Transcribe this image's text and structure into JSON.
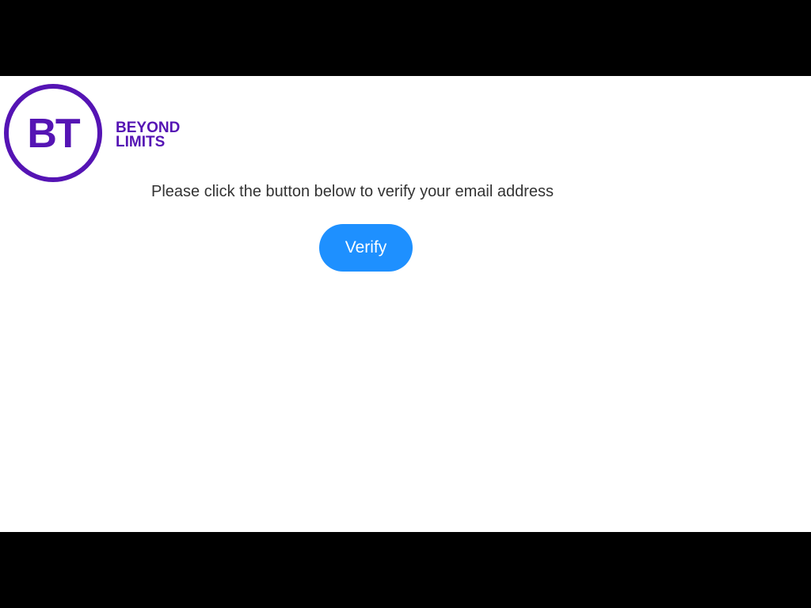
{
  "logo": {
    "initials": "BT",
    "tagline_line1": "BEYOND",
    "tagline_line2": "LIMITS"
  },
  "message": "Please click the button below to verify your email address",
  "verify_button": {
    "label": "Verify"
  },
  "colors": {
    "brand_purple": "#5514b4",
    "button_blue": "#1e90ff",
    "text": "#333333"
  }
}
